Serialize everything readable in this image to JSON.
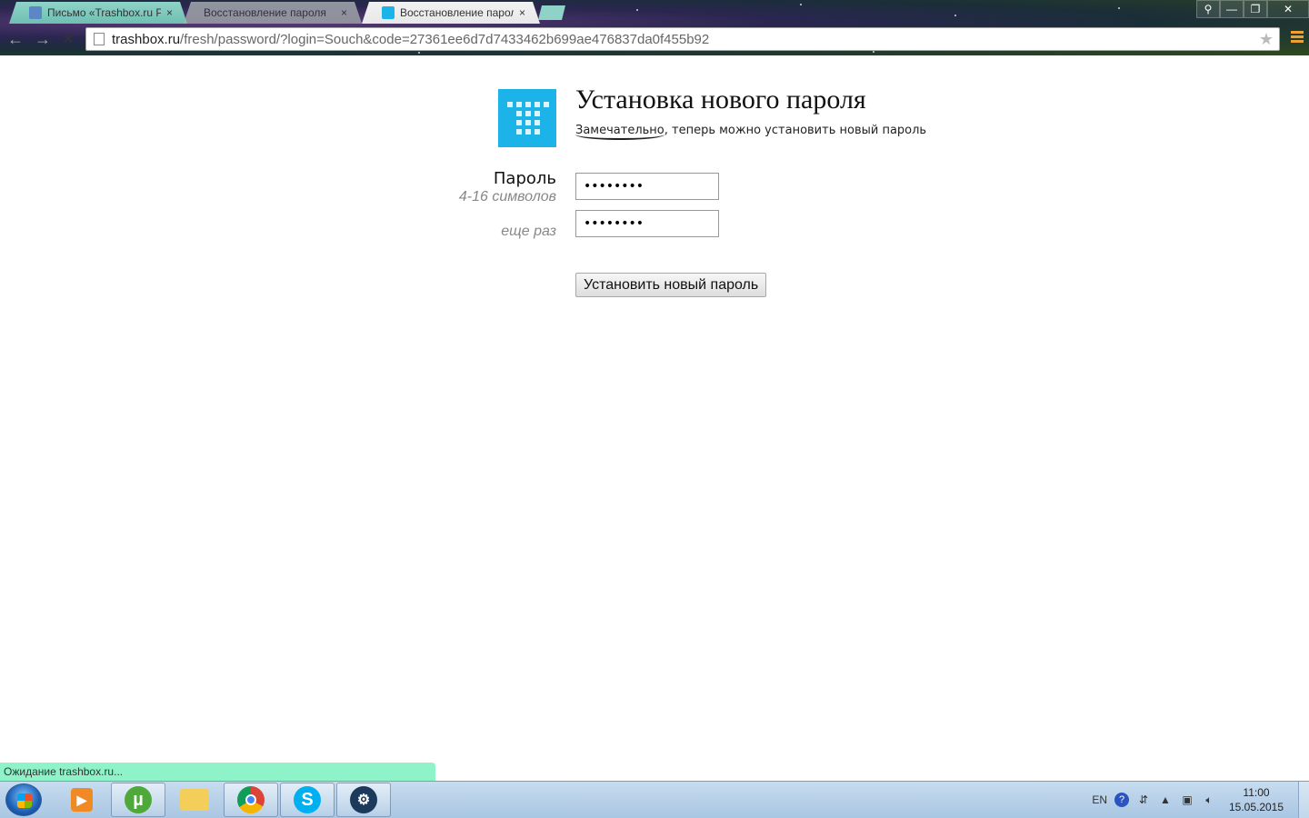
{
  "browser": {
    "tabs": [
      {
        "title": "Письмо «Trashbox.ru Pas",
        "close": "×"
      },
      {
        "title": "Восстановление пароля",
        "close": "×"
      },
      {
        "title": "Восстановление пароля",
        "close": "×"
      }
    ],
    "url_domain": "trashbox.ru",
    "url_path": "/fresh/password/?login=Souch&code=27361ee6d7d7433462b699ae476837da0f455b92"
  },
  "page": {
    "title": "Установка нового пароля",
    "subtitle_highlight": "Замечательно",
    "subtitle_rest": ", теперь можно установить новый пароль",
    "password_label": "Пароль",
    "password_hint": "4-16 символов",
    "repeat_label": "еще раз",
    "password_value": "••••••••",
    "repeat_value": "••••••••",
    "submit_label": "Установить новый пароль"
  },
  "status_bar": "Ожидание trashbox.ru...",
  "taskbar": {
    "lang": "EN",
    "time": "11:00",
    "date": "15.05.2015"
  },
  "colors": {
    "logo": "#1cb4e8",
    "status_bar": "#8ef3c8"
  }
}
